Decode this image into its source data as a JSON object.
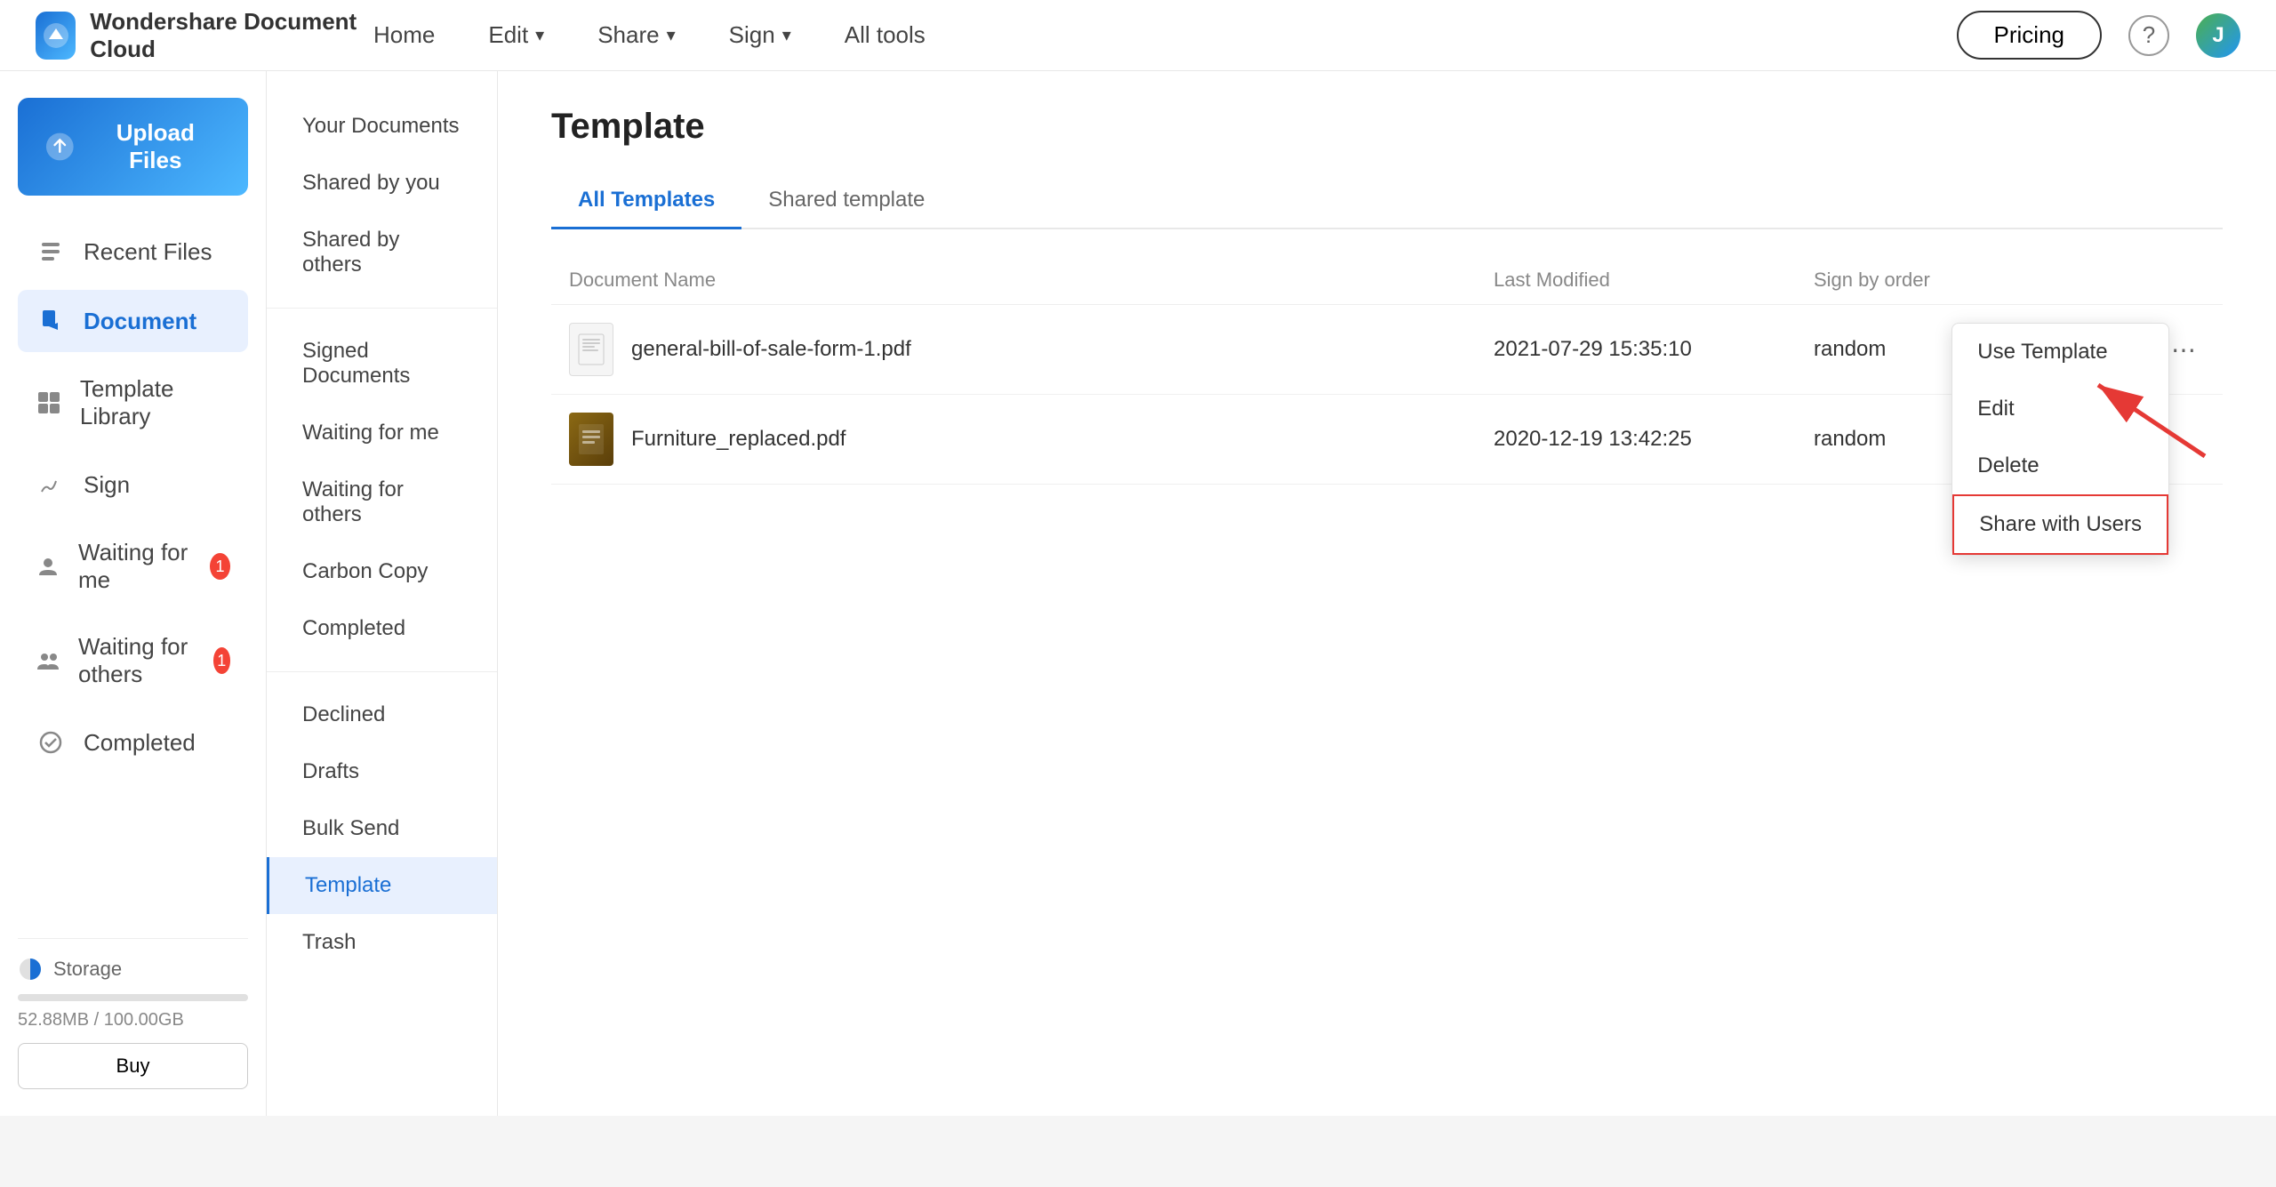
{
  "app": {
    "name": "Wondershare Document Cloud"
  },
  "nav": {
    "home": "Home",
    "edit": "Edit",
    "share": "Share",
    "sign": "Sign",
    "all_tools": "All tools",
    "pricing": "Pricing",
    "avatar_letter": "J"
  },
  "upload": {
    "label": "Upload Files"
  },
  "left_sidebar": {
    "items": [
      {
        "id": "recent-files",
        "label": "Recent Files"
      },
      {
        "id": "document",
        "label": "Document",
        "active": true
      },
      {
        "id": "template-library",
        "label": "Template Library"
      },
      {
        "id": "sign",
        "label": "Sign"
      },
      {
        "id": "waiting-for-me",
        "label": "Waiting for me",
        "badge": "1"
      },
      {
        "id": "waiting-for-others",
        "label": "Waiting for others",
        "badge": "1"
      },
      {
        "id": "completed",
        "label": "Completed"
      }
    ],
    "storage": {
      "label": "Storage",
      "used": "52.88MB",
      "total": "100.00GB",
      "text": "52.88MB / 100.00GB",
      "buy_label": "Buy"
    }
  },
  "mid_sidebar": {
    "items": [
      {
        "id": "your-documents",
        "label": "Your Documents"
      },
      {
        "id": "shared-by-you",
        "label": "Shared by you"
      },
      {
        "id": "shared-by-others",
        "label": "Shared by others"
      },
      {
        "id": "signed-documents",
        "label": "Signed Documents"
      },
      {
        "id": "waiting-for-me",
        "label": "Waiting for me"
      },
      {
        "id": "waiting-for-others",
        "label": "Waiting for others"
      },
      {
        "id": "carbon-copy",
        "label": "Carbon Copy"
      },
      {
        "id": "completed",
        "label": "Completed"
      },
      {
        "id": "declined",
        "label": "Declined"
      },
      {
        "id": "drafts",
        "label": "Drafts"
      },
      {
        "id": "bulk-send",
        "label": "Bulk Send"
      },
      {
        "id": "template",
        "label": "Template",
        "active": true
      },
      {
        "id": "trash",
        "label": "Trash"
      }
    ]
  },
  "main": {
    "title": "Template",
    "tabs": [
      {
        "id": "all-templates",
        "label": "All Templates",
        "active": true
      },
      {
        "id": "shared-template",
        "label": "Shared template"
      }
    ],
    "table": {
      "headers": {
        "doc_name": "Document Name",
        "last_modified": "Last Modified",
        "sign_by_order": "Sign by order"
      },
      "rows": [
        {
          "id": "row-1",
          "name": "general-bill-of-sale-form-1.pdf",
          "last_modified": "2021-07-29 15:35:10",
          "sign_by_order": "random",
          "has_menu": true
        },
        {
          "id": "row-2",
          "name": "Furniture_replaced.pdf",
          "last_modified": "2020-12-19 13:42:25",
          "sign_by_order": "random",
          "has_menu": false
        }
      ]
    },
    "context_menu": {
      "items": [
        {
          "id": "use-template",
          "label": "Use Template"
        },
        {
          "id": "edit",
          "label": "Edit"
        },
        {
          "id": "delete",
          "label": "Delete"
        },
        {
          "id": "share-with-users",
          "label": "Share with Users",
          "highlighted": true
        }
      ]
    }
  }
}
